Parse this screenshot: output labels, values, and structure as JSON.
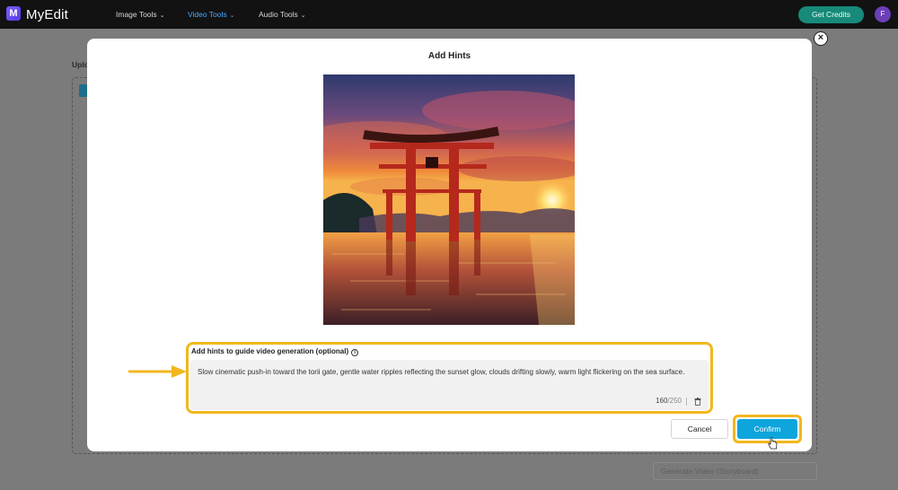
{
  "app": {
    "name": "MyEdit",
    "logo_letter": "M",
    "nav": [
      {
        "label": "Image Tools",
        "active": false
      },
      {
        "label": "Video Tools",
        "active": true
      },
      {
        "label": "Audio Tools",
        "active": false
      }
    ],
    "credits_label": "Get Credits",
    "avatar_initial": "F",
    "accent_color": "#0ea5dd",
    "highlight_color": "#f2b71e"
  },
  "background": {
    "upload_label": "Uplo",
    "generate_label": "Generate Video (Storyboard)"
  },
  "modal": {
    "title": "Add Hints",
    "preview_alt": "torii gate at sunset over sea",
    "hint_label": "Add hints to guide video generation (optional)",
    "hint_text": "Slow cinematic push-in toward the torii gate, gentle water ripples reflecting the sunset glow, clouds drifting slowly, warm light flickering on the sea surface.",
    "char_count": "160",
    "char_max": "/250",
    "cancel_label": "Cancel",
    "confirm_label": "Confirm"
  },
  "icons": {
    "close": "×",
    "info": "i",
    "chevron": "⌄"
  }
}
